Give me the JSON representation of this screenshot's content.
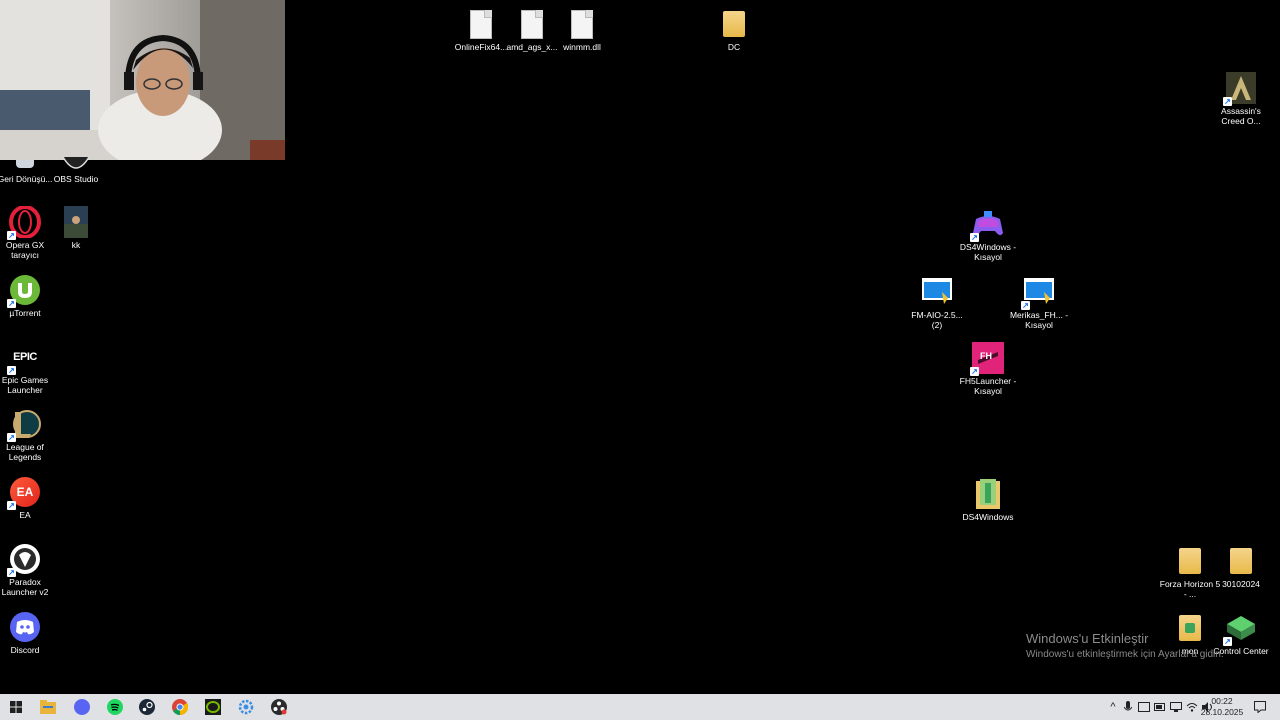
{
  "desktop_icons": {
    "onlinefix": {
      "label": "OnlineFix64..."
    },
    "amd_ags": {
      "label": "amd_ags_x..."
    },
    "winmm": {
      "label": "winmm.dll"
    },
    "dc": {
      "label": "DC"
    },
    "assassins": {
      "label": "Assassin's Creed O..."
    },
    "recycle": {
      "label": "Geri Dönüşü..."
    },
    "obs": {
      "label": "OBS Studio"
    },
    "opera": {
      "label": "Opera GX tarayıcı"
    },
    "kk": {
      "label": "kk"
    },
    "utorrent": {
      "label": "µTorrent"
    },
    "epic": {
      "label": "Epic Games Launcher",
      "icon_text": "EPIC"
    },
    "lol": {
      "label": "League of Legends"
    },
    "ea": {
      "label": "EA",
      "icon_text": "EA"
    },
    "paradox": {
      "label": "Paradox Launcher v2"
    },
    "discord": {
      "label": "Discord"
    },
    "ds4_shortcut": {
      "label": "DS4Windows - Kısayol"
    },
    "fm_aio": {
      "label": "FM-AIO-2.5... (2)"
    },
    "merikas": {
      "label": "Merikas_FH... - Kısayol"
    },
    "fh5": {
      "label": "FH5Launcher - Kısayol"
    },
    "ds4": {
      "label": "DS4Windows"
    },
    "forza": {
      "label": "Forza Horizon 5 - ..."
    },
    "f30102024": {
      "label": "30102024"
    },
    "mon": {
      "label": "mon"
    },
    "control": {
      "label": "Control Center"
    }
  },
  "watermark": {
    "title": "Windows'u Etkinleştir",
    "subtitle": "Windows'u etkinleştirmek için Ayarlar'a gidin."
  },
  "clock": {
    "time": "00:22",
    "date": "28.10.2025"
  },
  "colors": {
    "taskbar": "#dfe1e4",
    "desktop": "#000000"
  }
}
